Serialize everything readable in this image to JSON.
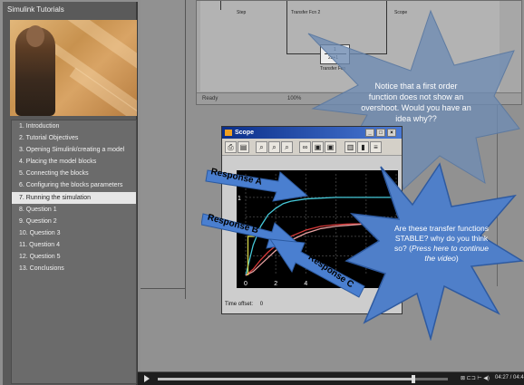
{
  "panel": {
    "title": "Simulink Tutorials",
    "menu": [
      {
        "label": "1. Introduction",
        "active": false
      },
      {
        "label": "2. Tutorial Objectives",
        "active": false
      },
      {
        "label": "3. Opening Simulink/creating a model",
        "active": false
      },
      {
        "label": "4. Placing the model blocks",
        "active": false
      },
      {
        "label": "5. Connecting the blocks",
        "active": false
      },
      {
        "label": "6. Configuring the blocks parameters",
        "active": false
      },
      {
        "label": "7. Running the simulation",
        "active": true
      },
      {
        "label": "8. Question 1",
        "active": false
      },
      {
        "label": "9. Question 2",
        "active": false
      },
      {
        "label": "10. Question 3",
        "active": false
      },
      {
        "label": "11. Question 4",
        "active": false
      },
      {
        "label": "12. Question 5",
        "active": false
      },
      {
        "label": "13. Conclusions",
        "active": false
      }
    ]
  },
  "model": {
    "blocks": {
      "step": "Step",
      "tf2": "Transfer Fcn 2",
      "scope": "Scope",
      "tf_num": "1",
      "tf_den": "2s+1",
      "tf": "Transfer Fcn"
    },
    "status_left": "Ready",
    "status_zoom": "100%"
  },
  "scope": {
    "title": "Scope",
    "time_offset_label": "Time offset:",
    "time_offset_value": "0",
    "icons": [
      "print-icon",
      "params-icon",
      "zoom-in-icon",
      "zoom-x-icon",
      "zoom-y-icon",
      "binoculars-icon",
      "save-axes-icon",
      "restore-axes-icon",
      "floating-scope-icon",
      "lock-icon",
      "signal-selector-icon"
    ]
  },
  "callouts": {
    "overshoot": "Notice that a first order function does not show an overshoot. Would you have an idea why??",
    "stable_main": "Are these transfer functions STABLE? why do you think so? (",
    "stable_italic": "Press here to continue the video",
    "stable_end": ")"
  },
  "arrows": {
    "a": "Response A",
    "b": "Response B",
    "c": "Response C"
  },
  "chart_data": {
    "type": "line",
    "title": "",
    "xlabel": "",
    "ylabel": "",
    "x_ticks": [
      "0",
      "2",
      "4"
    ],
    "y_ticks": [
      "1"
    ],
    "xlim": [
      0,
      10
    ],
    "ylim": [
      0,
      1.3
    ],
    "background": "#000000",
    "series": [
      {
        "color": "#45c8d8",
        "x": [
          0,
          0.5,
          1,
          1.5,
          2,
          2.5,
          3,
          4,
          5,
          6,
          7,
          8,
          10
        ],
        "y": [
          0,
          0.39,
          0.63,
          0.78,
          0.86,
          0.92,
          0.95,
          0.98,
          0.99,
          1,
          1,
          1,
          1
        ]
      },
      {
        "color": "#d83a3a",
        "x": [
          0,
          0.5,
          1,
          1.5,
          2,
          3,
          4,
          5,
          6,
          7,
          8,
          10
        ],
        "y": [
          0,
          0.08,
          0.2,
          0.3,
          0.38,
          0.5,
          0.58,
          0.63,
          0.65,
          0.66,
          0.66,
          0.66
        ]
      },
      {
        "color": "#e6a0a0",
        "x": [
          0,
          0.5,
          1,
          1.5,
          2,
          3,
          4,
          5,
          6,
          8,
          10
        ],
        "y": [
          0,
          0.05,
          0.14,
          0.23,
          0.32,
          0.45,
          0.54,
          0.6,
          0.63,
          0.66,
          0.66
        ]
      },
      {
        "color": "#d8d84a",
        "x": [
          0.15,
          0.15,
          0.6
        ],
        "y": [
          0,
          0.5,
          0.5
        ]
      }
    ]
  },
  "media": {
    "icons": "⊠ ⊏⊐ ⊢ ◀)",
    "timecode": "04:27 / 04:4",
    "progress": 0.88
  }
}
